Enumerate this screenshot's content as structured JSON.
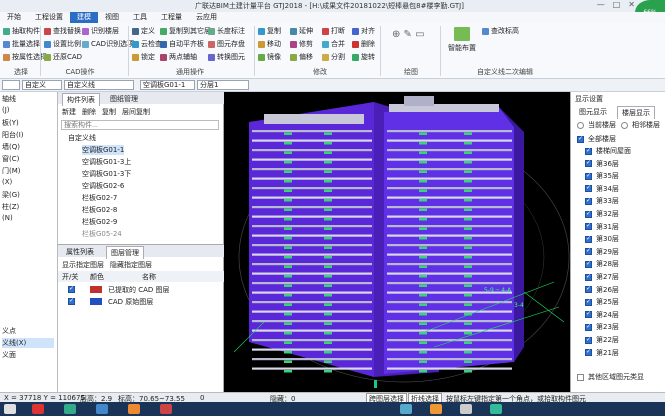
{
  "window": {
    "title": "广联达BIM土建计量平台 GTJ2018 - [H:\\成果文件20181022\\短棒悬包8#楼李勤.GTJ]",
    "logo": "66%"
  },
  "menu": [
    "开始",
    "工程设置",
    "建模",
    "视图",
    "工具",
    "工程量",
    "云应用"
  ],
  "ribbon": {
    "left_items": [
      "抽取构件",
      "批量选择",
      "按属性选择"
    ],
    "cad_items": [
      "查找替换",
      "设置比例",
      "还原CAD"
    ],
    "layer_items": [
      "识别楼层",
      "CAD识别选项"
    ],
    "general_items": [
      "定义",
      "云检查",
      "锁定",
      "复制到其它层",
      "自动平齐板",
      "两点辅轴",
      "长度标注",
      "图元存盘",
      "转换图元"
    ],
    "modify_items": [
      "复制",
      "移动",
      "镜像",
      "延伸",
      "修剪",
      "偏移",
      "打断",
      "合并",
      "分割",
      "对齐",
      "删除",
      "旋转"
    ],
    "draw_label": "绘图",
    "smart_label": "智能布置",
    "check_label": "查改标高",
    "groups": [
      "选择",
      "CAD操作",
      "通用操作",
      "修改",
      "绘图",
      "自定义线二次编辑"
    ]
  },
  "propbar": {
    "combo1": "",
    "combo2": "自定义",
    "combo3": "自定义线",
    "combo4": "空调板G01-1",
    "combo5": "分层1"
  },
  "left_panel": {
    "items": [
      "轴线",
      "(J)",
      "板(Y)",
      "阳台(I)",
      "墙(Q)",
      "窗(C)",
      "门(M)",
      "(X)",
      "梁(G)",
      "柱(Z)",
      "(N)"
    ],
    "bottom_items": [
      "义点",
      "义线(X)",
      "义面"
    ]
  },
  "component_list": {
    "tabs": [
      "构件列表",
      "图纸管理"
    ],
    "toolbar": [
      "新建",
      "删除",
      "复制",
      "层间复制"
    ],
    "search_placeholder": "搜索构件...",
    "root": "自定义线",
    "items": [
      "空调板G01-1",
      "空调板G01-3上",
      "空调板G01-3下",
      "空调板G02-6",
      "栏板G02-7",
      "栏板G02-8",
      "栏板G02-9",
      "栏板G05-24"
    ]
  },
  "layer_panel": {
    "tabs": [
      "属性列表",
      "图层管理"
    ],
    "options": [
      "显示指定图层",
      "隐藏指定图层"
    ],
    "headers": [
      "开/关",
      "颜色",
      "名称"
    ],
    "rows": [
      {
        "name": "已提取的 CAD 图层",
        "color": "#c03030"
      },
      {
        "name": "CAD 原始图层",
        "color": "#2050c0"
      }
    ]
  },
  "right_panel": {
    "title": "显示设置",
    "tabs": [
      "图元显示",
      "楼层显示"
    ],
    "radio": [
      "当前楼层",
      "相邻楼层"
    ],
    "all_floors": "全部楼层",
    "floors": [
      "楼梯间屋面",
      "第36层",
      "第35层",
      "第34层",
      "第33层",
      "第32层",
      "第31层",
      "第30层",
      "第29层",
      "第28层",
      "第27层",
      "第26层",
      "第25层",
      "第24层",
      "第23层",
      "第22层",
      "第21层"
    ],
    "other": "其他区域图元类显"
  },
  "status": {
    "coords": "X = 37718 Y = 110675",
    "floor_height": "层高：2.9",
    "elevation": "标高：70.65~73.55",
    "zero": "0",
    "hidden": "隐藏：0",
    "btn1": "跨图层选择",
    "btn2": "折线选择",
    "hint": "按鼠标左键指定第一个角点，或拾取构件图元"
  },
  "colors": {
    "accent": "#2b6cc4",
    "building": "#6a2ee8",
    "viewport_bg": "#000000"
  }
}
